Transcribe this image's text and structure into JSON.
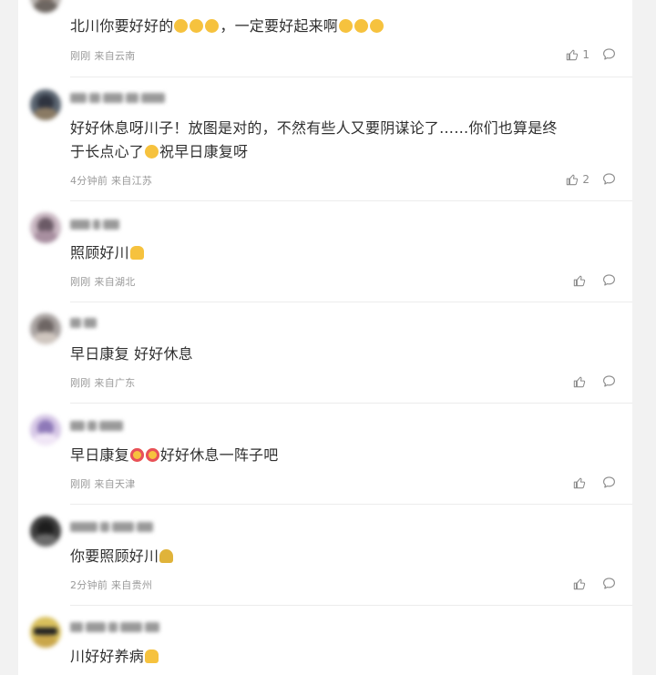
{
  "comments": [
    {
      "text_a": "北川你要好好的",
      "text_b": "，一定要好起来啊",
      "meta": "刚刚 来自云南",
      "likes": "1",
      "avatar_colors": [
        "#b9b4b0",
        "#8c7d74",
        "#6d6661"
      ],
      "emoji_icon": "crying-face-emoji-icon"
    },
    {
      "line1": "好好休息呀川子！放图是对的，不然有些人又要阴谋论了……你们也算是终",
      "line2a": "于长点心了",
      "line2b": "祝早日康复呀",
      "meta": "4分钟前 来自江苏",
      "likes": "2",
      "avatar_colors": [
        "#5a6470",
        "#2f3440",
        "#8a7a64"
      ],
      "emoji_icon": "laughing-face-emoji-icon"
    },
    {
      "text": "照顾好川",
      "meta": "刚刚 来自湖北",
      "likes": "",
      "avatar_colors": [
        "#c9b7c2",
        "#6b5a66",
        "#a88fa0"
      ],
      "emoji_icon": "person-hugging-emoji-icon"
    },
    {
      "text": "早日康复 好好休息",
      "meta": "刚刚 来自广东",
      "likes": "",
      "avatar_colors": [
        "#a8a2a0",
        "#6e6664",
        "#cfc6bf"
      ],
      "emoji_icon": ""
    },
    {
      "text_a": "早日康复",
      "text_b": "好好休息一阵子吧",
      "meta": "刚刚 来自天津",
      "likes": "",
      "avatar_colors": [
        "#d6c7e6",
        "#8e79b8",
        "#f0e6f6"
      ],
      "emoji_icon": "heart-eyes-emoji-icon"
    },
    {
      "text": "你要照顾好川",
      "meta": "2分钟前 来自贵州",
      "likes": "",
      "avatar_colors": [
        "#3c3c3c",
        "#1e1e1e",
        "#6a6a6a"
      ],
      "emoji_icon": "flower-bouquet-emoji-icon"
    },
    {
      "text": "川好好养病",
      "meta": "",
      "likes": "",
      "avatar_colors": [
        "#d9c05c",
        "#222222",
        "#c9a64a"
      ],
      "emoji_icon": "person-hugging-emoji-icon"
    }
  ],
  "colors": {
    "page_bg": "#f2f2f2",
    "card_bg": "#ffffff",
    "text": "#2f2f2f",
    "meta": "#9a9a9a",
    "icon": "#8c8c8c",
    "emoji_yellow": "#f6c23e"
  }
}
